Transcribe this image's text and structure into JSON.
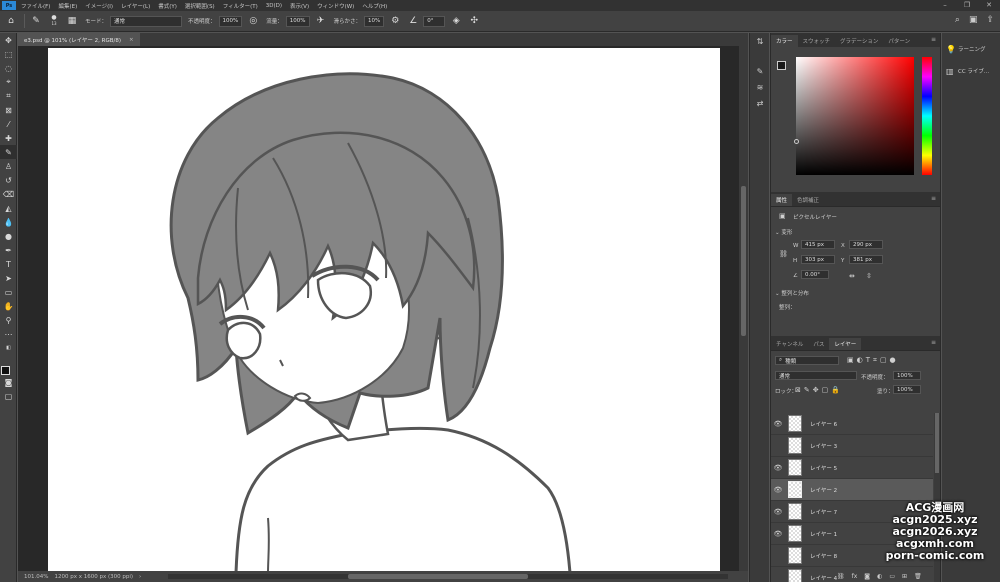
{
  "menubar": {
    "logo": "Ps",
    "items": [
      "ファイル(F)",
      "編集(E)",
      "イメージ(I)",
      "レイヤー(L)",
      "書式(Y)",
      "選択範囲(S)",
      "フィルター(T)",
      "3D(D)",
      "表示(V)",
      "ウィンドウ(W)",
      "ヘルプ(H)"
    ],
    "window_controls": [
      "–",
      "❐",
      "✕"
    ]
  },
  "options": {
    "mode_label": "モード：",
    "mode_value": "通常",
    "opacity_label": "不透明度：",
    "opacity_value": "100%",
    "flow_label": "流量：",
    "flow_value": "100%",
    "smoothing_label": "滑らかさ：",
    "smoothing_value": "10%",
    "angle_value": "0°",
    "brush_size": "13"
  },
  "document": {
    "tab_title": "e3.psd @ 101% (レイヤー 2, RGB/8)",
    "tab_close": "×"
  },
  "status": {
    "zoom": "101.04%",
    "size": "1200 px x 1600 px (300 ppi)",
    "arrow": "›"
  },
  "color_panel": {
    "tabs": [
      "カラー",
      "スウォッチ",
      "グラデーション",
      "パターン"
    ]
  },
  "props_panel": {
    "tabs": [
      "属性",
      "色調補正"
    ],
    "layer_type": "ピクセルレイヤー",
    "transform_label": "変形",
    "w_label": "W",
    "w_value": "415 px",
    "x_label": "X",
    "x_value": "290 px",
    "h_label": "H",
    "h_value": "303 px",
    "y_label": "Y",
    "y_value": "381 px",
    "angle_value": "0.00°",
    "align_label": "整列と分布",
    "align_sub": "整列："
  },
  "layers_panel": {
    "tabs": [
      "チャンネル",
      "パス",
      "レイヤー"
    ],
    "filter_kind": "種類",
    "blend_mode": "通常",
    "opacity_label": "不透明度：",
    "opacity_value": "100%",
    "lock_label": "ロック：",
    "fill_label": "塗り：",
    "fill_value": "100%",
    "layers": [
      {
        "name": "レイヤー 6",
        "visible": true,
        "selected": false
      },
      {
        "name": "レイヤー 3",
        "visible": false,
        "selected": false
      },
      {
        "name": "レイヤー 5",
        "visible": true,
        "selected": false
      },
      {
        "name": "レイヤー 2",
        "visible": true,
        "selected": true
      },
      {
        "name": "レイヤー 7",
        "visible": true,
        "selected": false
      },
      {
        "name": "レイヤー 1",
        "visible": true,
        "selected": false
      },
      {
        "name": "レイヤー 8",
        "visible": false,
        "selected": false
      },
      {
        "name": "レイヤー 4",
        "visible": false,
        "selected": false
      }
    ]
  },
  "right_strip": {
    "items": [
      "ラーニング",
      "CC ライブ..."
    ]
  },
  "watermark": {
    "lines": [
      "ACG漫画网",
      "acgn2025.xyz",
      "acgn2026.xyz",
      "acgxmh.com",
      "porn-comic.com"
    ]
  }
}
